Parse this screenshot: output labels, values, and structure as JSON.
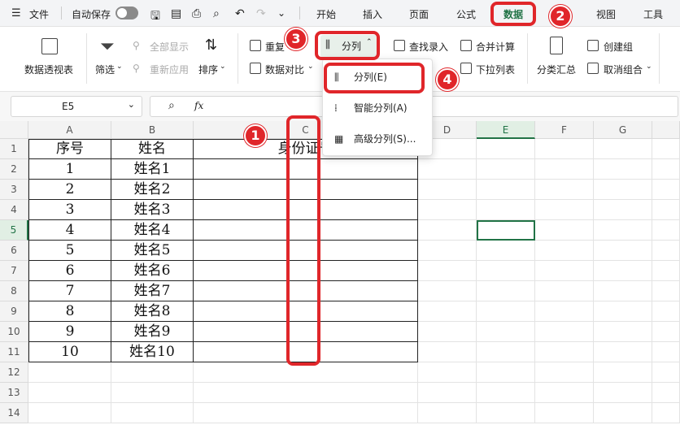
{
  "titlebar": {
    "menu_icon": "hamburger-icon",
    "file": "文件",
    "autosave": "自动保存",
    "tabs": [
      "开始",
      "插入",
      "页面",
      "公式",
      "数据",
      "视图",
      "工具"
    ],
    "active_tab": "数据"
  },
  "ribbon": {
    "pivot": "数据透视表",
    "filter": "筛选",
    "show_all": "全部显示",
    "reapply": "重新应用",
    "sort": "排序",
    "dedupe": "重复",
    "compare": "数据对比",
    "split": "分列",
    "lookup_entry": "查找录入",
    "dropdown_list": "下拉列表",
    "merge_calc": "合并计算",
    "subtotal": "分类汇总",
    "create_group": "创建组",
    "ungroup": "取消组合"
  },
  "formula_bar": {
    "namebox": "E5",
    "fx": "fx",
    "content": ""
  },
  "dropdown": {
    "items": [
      "分列(E)",
      "智能分列(A)",
      "高级分列(S)..."
    ]
  },
  "sheet": {
    "columns": [
      "A",
      "B",
      "C",
      "D",
      "E",
      "F",
      "G"
    ],
    "rows": [
      "1",
      "2",
      "3",
      "4",
      "5",
      "6",
      "7",
      "8",
      "9",
      "10",
      "11",
      "12",
      "13",
      "14"
    ],
    "headers": [
      "序号",
      "姓名",
      "身份证号"
    ],
    "data": [
      [
        "1",
        "姓名1"
      ],
      [
        "2",
        "姓名2"
      ],
      [
        "3",
        "姓名3"
      ],
      [
        "4",
        "姓名4"
      ],
      [
        "5",
        "姓名5"
      ],
      [
        "6",
        "姓名6"
      ],
      [
        "7",
        "姓名7"
      ],
      [
        "8",
        "姓名8"
      ],
      [
        "9",
        "姓名9"
      ],
      [
        "10",
        "姓名10"
      ]
    ],
    "selected_cell": "E5"
  },
  "annotations": [
    "1",
    "2",
    "3",
    "4"
  ],
  "colors": {
    "accent": "#217346",
    "annotation": "#e0262a"
  }
}
